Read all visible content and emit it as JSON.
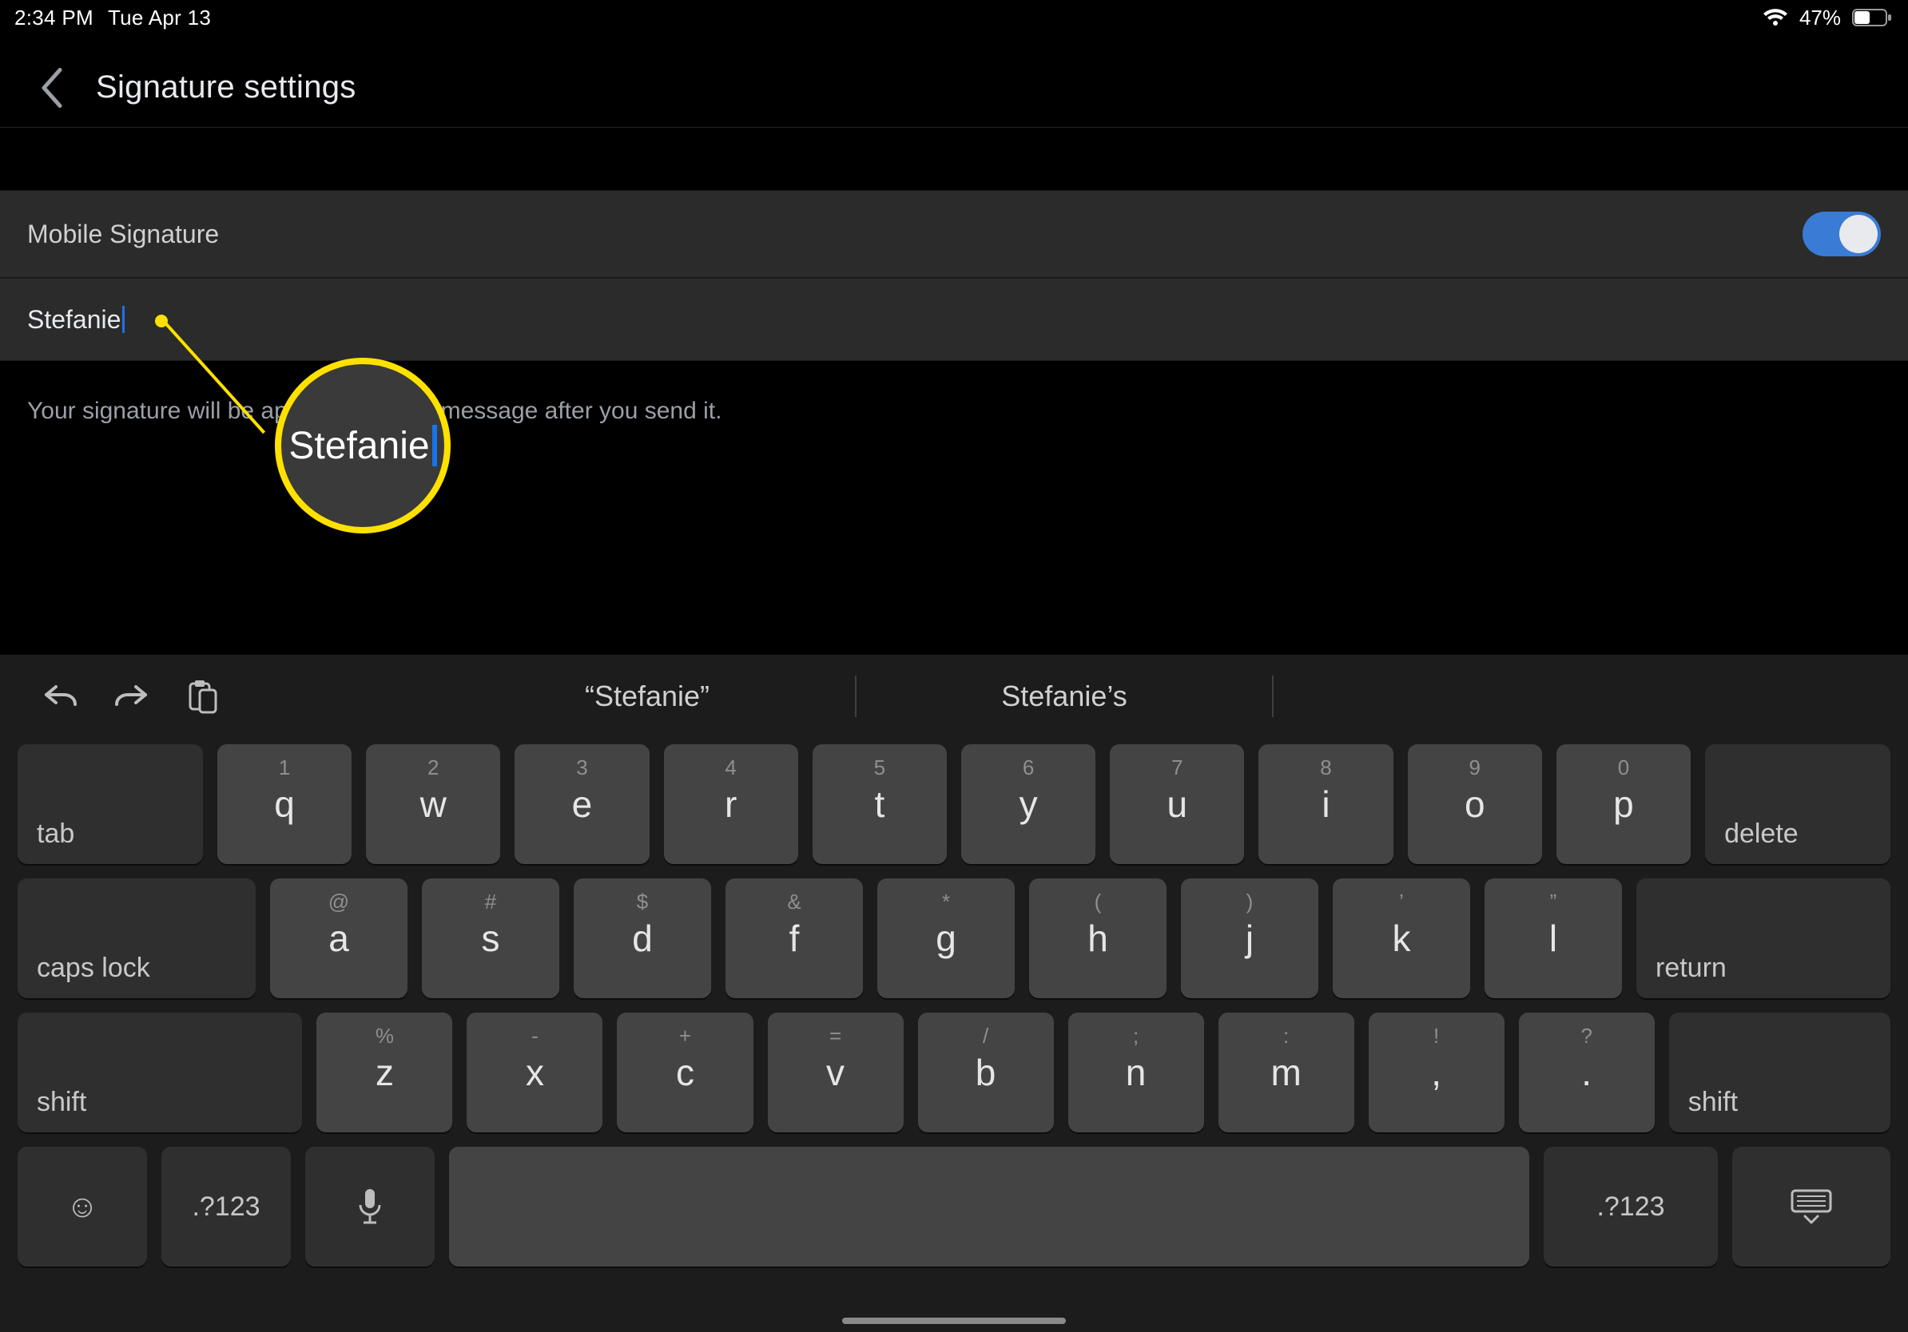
{
  "status": {
    "time": "2:34 PM",
    "date": "Tue Apr 13",
    "battery_pct": "47%"
  },
  "header": {
    "title": "Signature settings"
  },
  "settings": {
    "mobile_signature_label": "Mobile Signature",
    "signature_value": "Stefanie",
    "helper_text": "Your signature will be appended to the message after you send it."
  },
  "magnifier": {
    "text": "Stefanie"
  },
  "keyboard": {
    "suggestions": [
      "“Stefanie”",
      "Stefanie’s"
    ],
    "row1_hints": [
      "1",
      "2",
      "3",
      "4",
      "5",
      "6",
      "7",
      "8",
      "9",
      "0"
    ],
    "row1_letters": [
      "q",
      "w",
      "e",
      "r",
      "t",
      "y",
      "u",
      "i",
      "o",
      "p"
    ],
    "row2_hints": [
      "@",
      "#",
      "$",
      "&",
      "*",
      "(",
      ")",
      "’",
      "”"
    ],
    "row2_letters": [
      "a",
      "s",
      "d",
      "f",
      "g",
      "h",
      "j",
      "k",
      "l"
    ],
    "row3_hints": [
      "%",
      "-",
      "+",
      "=",
      "/",
      ";",
      ":",
      "!",
      "?"
    ],
    "row3_letters": [
      "z",
      "x",
      "c",
      "v",
      "b",
      "n",
      "m",
      ",",
      "."
    ],
    "tab": "tab",
    "delete": "delete",
    "caps": "caps lock",
    "return": "return",
    "shift": "shift",
    "numbers": ".?123"
  }
}
